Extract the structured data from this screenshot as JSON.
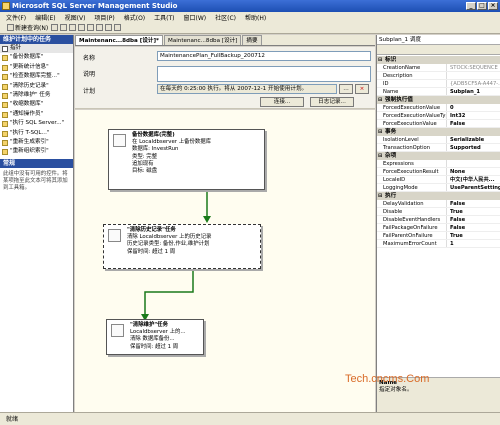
{
  "window": {
    "title": "Microsoft SQL Server Management Studio"
  },
  "menu": [
    "文件(F)",
    "编辑(E)",
    "视图(V)",
    "项目(P)",
    "格式(O)",
    "工具(T)",
    "窗口(W)",
    "社区(C)",
    "帮助(H)"
  ],
  "toolbar": {
    "new_query": "新建查询(N)"
  },
  "left_panel": {
    "toolbox_title": "维护计划中的任务",
    "tools": [
      "指针",
      "\"备份数据库\"",
      "\"更新统计信息\"",
      "\"检查数据库完整...\"",
      "\"清除历史记录\"",
      "\"清除维护\" 任务",
      "\"收缩数据库\"",
      "\"通知操作员\"",
      "\"执行 SQL Server...\"",
      "\"执行 T-SQL...\"",
      "\"重新生成索引\"",
      "\"重新组织索引\""
    ],
    "general_title": "常规",
    "general_text": "此组中没有可用的控件。将某项拖至此文本可将其添加到工具箱。"
  },
  "tabs": [
    "Maintenanc...8dba [设计]*",
    "Maintenanc...8dba [设计]",
    "摘要"
  ],
  "plan": {
    "name_label": "名称",
    "name_value": "MaintenancePlan_FullBackup_200712",
    "desc_label": "说明",
    "schedule_label": "计划",
    "schedule_value": "在每天的 0:25:00 执行。将从 2007-12-1 开始使用计划。",
    "connect_btn": "连接...",
    "log_btn": "日志记录..."
  },
  "tasks": [
    {
      "title": "备份数据库(完整)",
      "lines": [
        "在 Localdbserver 上备份数据库",
        "数据库: InvestRun",
        "类型: 完整",
        "追加现有",
        "目标: 磁盘"
      ]
    },
    {
      "title": "\"清除历史记录\"任务",
      "lines": [
        "清除 Localdbserver 上的历史记录",
        "历史记录类型: 备份,作业,维护计划",
        "保留时间: 超过 1 周"
      ]
    },
    {
      "title": "\"清除维护\"任务",
      "lines": [
        "Localdbserver 上的...",
        "清除 数据库备份...",
        "保留时间: 超过 1 周"
      ]
    }
  ],
  "properties": {
    "object": "Subplan_1 调度",
    "categories": [
      {
        "name": "标识",
        "rows": [
          [
            "CreationName",
            "STOCK:SEQUENCE",
            true
          ],
          [
            "Description",
            "",
            true
          ],
          [
            "ID",
            "{ADB5CF5A-A447-...",
            true
          ],
          [
            "Name",
            "Subplan_1",
            false
          ]
        ]
      },
      {
        "name": "强制执行值",
        "rows": [
          [
            "ForcedExecutionValue",
            "0",
            false
          ],
          [
            "ForcedExecutionValueType",
            "Int32",
            false
          ],
          [
            "ForceExecutionValue",
            "False",
            false
          ]
        ]
      },
      {
        "name": "事务",
        "rows": [
          [
            "IsolationLevel",
            "Serializable",
            false
          ],
          [
            "TransactionOption",
            "Supported",
            false
          ]
        ]
      },
      {
        "name": "杂项",
        "rows": [
          [
            "Expressions",
            "",
            false
          ],
          [
            "ForceExecutionResult",
            "None",
            false
          ],
          [
            "LocaleID",
            "中文(中华人民共...",
            false
          ],
          [
            "LoggingMode",
            "UseParentSetting",
            false
          ]
        ]
      },
      {
        "name": "执行",
        "rows": [
          [
            "DelayValidation",
            "False",
            false
          ],
          [
            "Disable",
            "True",
            false
          ],
          [
            "DisableEventHandlers",
            "False",
            false
          ],
          [
            "FailPackageOnFailure",
            "False",
            false
          ],
          [
            "FailParentOnFailure",
            "True",
            false
          ],
          [
            "MaximumErrorCount",
            "1",
            false
          ]
        ]
      }
    ],
    "desc_title": "Name",
    "desc_text": "指定对象名。"
  },
  "status": "就绪",
  "watermark": "Tech.cncms.Com"
}
